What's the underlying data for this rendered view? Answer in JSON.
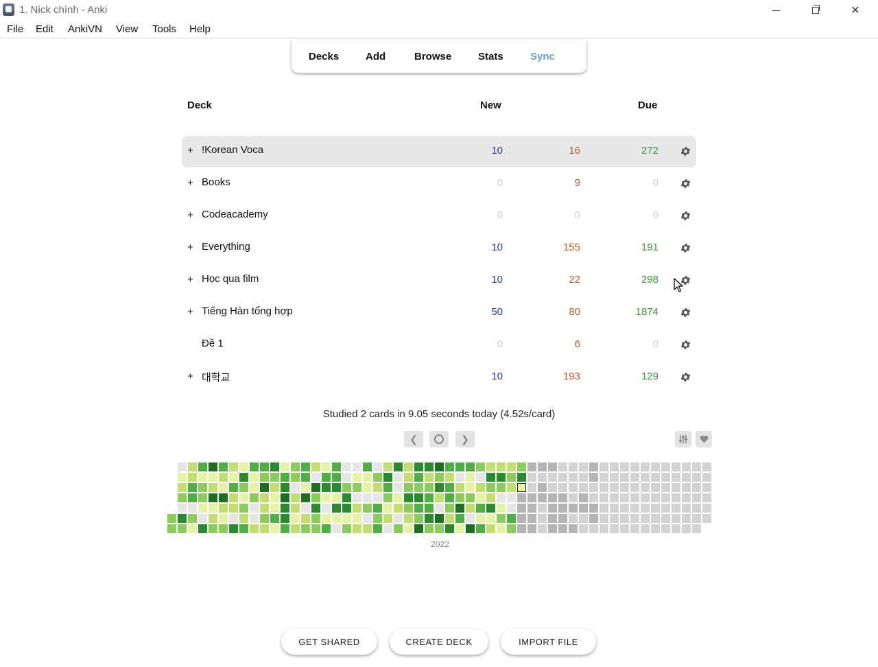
{
  "window": {
    "title": "1. Nick chính - Anki"
  },
  "menu": [
    "File",
    "Edit",
    "AnkiVN",
    "View",
    "Tools",
    "Help"
  ],
  "toolbar": {
    "decks": "Decks",
    "add": "Add",
    "browse": "Browse",
    "stats": "Stats",
    "sync": "Sync"
  },
  "table_headers": {
    "deck": "Deck",
    "new": "New",
    "due": "Due"
  },
  "decks": [
    {
      "name": "!Korean Voca",
      "expand": "+",
      "new": "10",
      "learn": "16",
      "due": "272"
    },
    {
      "name": "Books",
      "expand": "+",
      "new": "0",
      "learn": "9",
      "due": "0"
    },
    {
      "name": "Codeacademy",
      "expand": "+",
      "new": "0",
      "learn": "0",
      "due": "0"
    },
    {
      "name": "Everything",
      "expand": "+",
      "new": "10",
      "learn": "155",
      "due": "191"
    },
    {
      "name": "Học qua film",
      "expand": "+",
      "new": "10",
      "learn": "22",
      "due": "298"
    },
    {
      "name": "Tiếng Hàn tổng hợp",
      "expand": "+",
      "new": "50",
      "learn": "80",
      "due": "1874"
    },
    {
      "name": "Đề 1",
      "expand": "",
      "new": "0",
      "learn": "6",
      "due": "0"
    },
    {
      "name": "대학교",
      "expand": "+",
      "new": "10",
      "learn": "193",
      "due": "129"
    }
  ],
  "stats": {
    "studied_today": "Studied 2 cards in 9.05 seconds today (4.52s/card)"
  },
  "heatmap": {
    "year": "2022",
    "legend_levels": [
      "#e6e6e6",
      "#e6f2a6",
      "#c3de70",
      "#8ccc5c",
      "#4fae44",
      "#2a8a2e",
      "#1e6e24",
      "#b4b4b4",
      "#d3d3d3"
    ]
  },
  "buttons": {
    "get_shared": "GET SHARED",
    "create_deck": "CREATE DECK",
    "import_file": "IMPORT FILE"
  },
  "colors": {
    "new": "#1f3e9b",
    "learning": "#b85c2a",
    "due": "#3a9c32",
    "sync": "#6a9fd2"
  }
}
